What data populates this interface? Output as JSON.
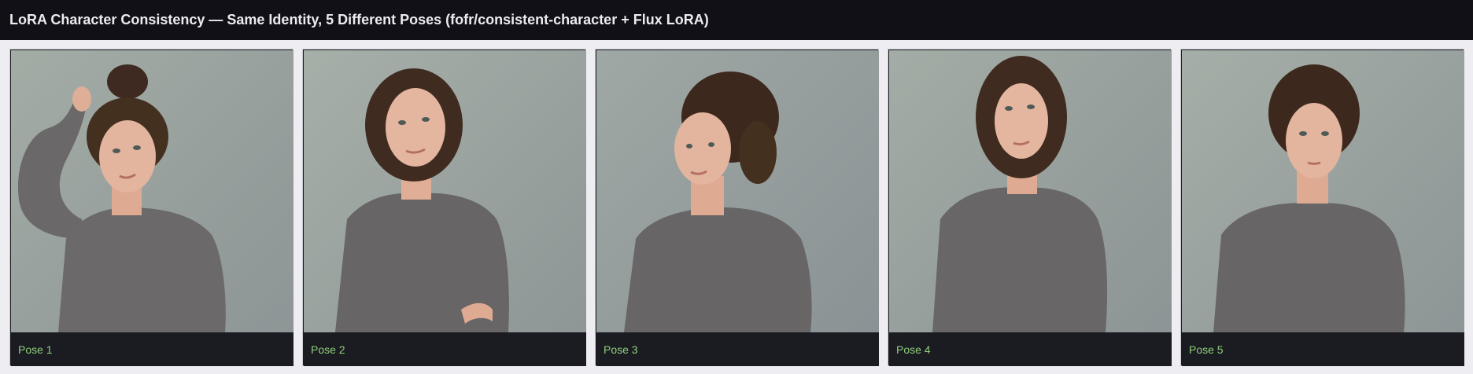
{
  "header": {
    "title": "LoRA Character Consistency — Same Identity, 5 Different Poses (fofr/consistent-character + Flux LoRA)"
  },
  "gallery": {
    "items": [
      {
        "caption": "Pose 1",
        "image": "portrait-photo"
      },
      {
        "caption": "Pose 2",
        "image": "portrait-photo"
      },
      {
        "caption": "Pose 3",
        "image": "portrait-photo"
      },
      {
        "caption": "Pose 4",
        "image": "portrait-photo"
      },
      {
        "caption": "Pose 5",
        "image": "portrait-photo"
      }
    ]
  },
  "colors": {
    "header_bg": "#111016",
    "page_bg": "#eeeef2",
    "caption_bg": "#1b1b22",
    "caption_text": "#8fd07a"
  }
}
